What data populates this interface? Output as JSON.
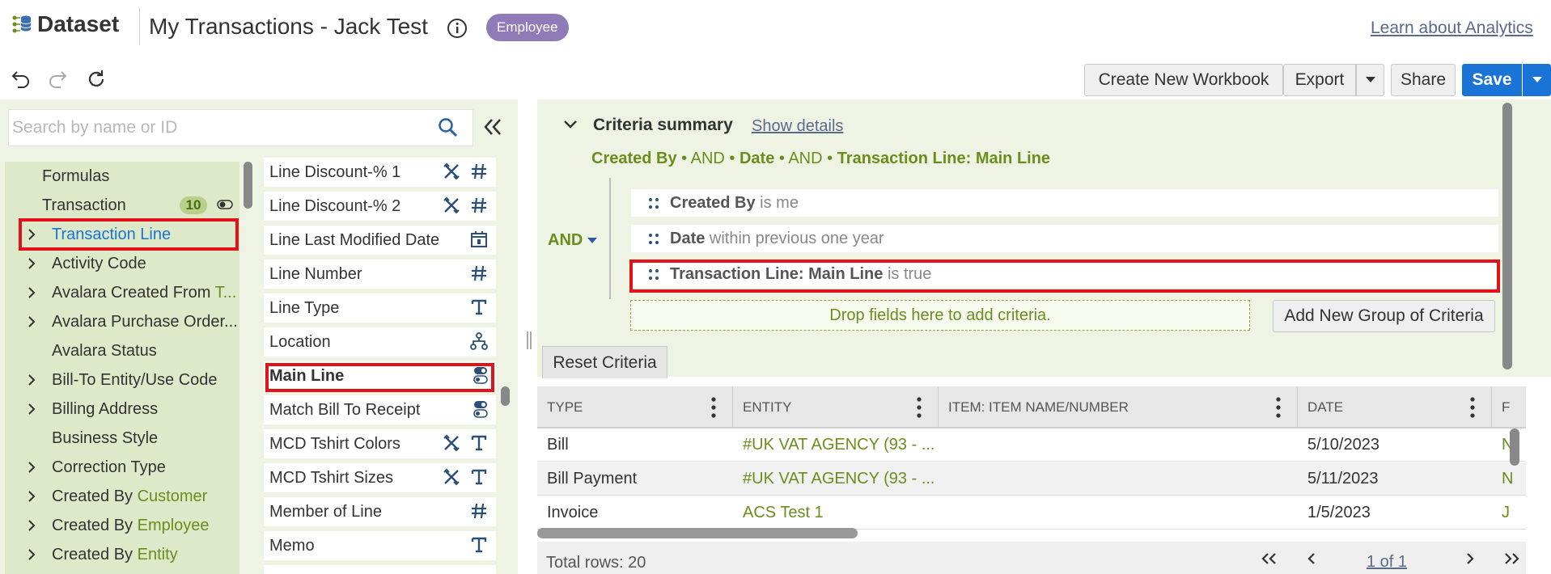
{
  "header": {
    "logo_text": "Dataset",
    "title": "My Transactions - Jack Test",
    "badge": "Employee",
    "learn_link": "Learn about Analytics"
  },
  "toolbar": {
    "create_workbook": "Create New Workbook",
    "export": "Export",
    "share": "Share",
    "save": "Save"
  },
  "search": {
    "placeholder": "Search by name or ID"
  },
  "tree": {
    "items": [
      {
        "label": "Formulas",
        "suffix": ""
      },
      {
        "label": "Transaction",
        "suffix": "",
        "count": "10"
      },
      {
        "label": "Transaction Line",
        "suffix": ""
      },
      {
        "label": "Activity Code",
        "suffix": ""
      },
      {
        "label": "Avalara Created From ",
        "suffix": "T..."
      },
      {
        "label": "Avalara Purchase Order...",
        "suffix": ""
      },
      {
        "label": "Avalara Status",
        "suffix": ""
      },
      {
        "label": "Bill-To Entity/Use Code",
        "suffix": ""
      },
      {
        "label": "Billing Address",
        "suffix": ""
      },
      {
        "label": "Business Style",
        "suffix": ""
      },
      {
        "label": "Correction Type",
        "suffix": ""
      },
      {
        "label": "Created By ",
        "suffix": "Customer"
      },
      {
        "label": "Created By ",
        "suffix": "Employee"
      },
      {
        "label": "Created By ",
        "suffix": "Entity"
      }
    ]
  },
  "fields": {
    "items": [
      {
        "label": "Line Discount-% 1",
        "icon": "number-icon"
      },
      {
        "label": "Line Discount-% 2",
        "icon": "number-icon"
      },
      {
        "label": "Line Last Modified Date",
        "icon": "calendar-icon"
      },
      {
        "label": "Line Number",
        "icon": "number-icon"
      },
      {
        "label": "Line Type",
        "icon": "text-icon"
      },
      {
        "label": "Location",
        "icon": "hierarchy-icon"
      },
      {
        "label": "Main Line",
        "icon": "toggle-icon"
      },
      {
        "label": "Match Bill To Receipt",
        "icon": "toggle-icon"
      },
      {
        "label": "MCD Tshirt Colors",
        "icon": "text-icon"
      },
      {
        "label": "MCD Tshirt Sizes",
        "icon": "text-icon"
      },
      {
        "label": "Member of Line",
        "icon": "number-icon"
      },
      {
        "label": "Memo",
        "icon": "text-icon"
      }
    ]
  },
  "criteria": {
    "title": "Criteria summary",
    "show_details": "Show details",
    "summary": {
      "f1": "Created By",
      "op1": " • AND • ",
      "f2": "Date",
      "op2": " • AND • ",
      "f3": "Transaction Line: Main Line"
    },
    "group_op": "AND",
    "rows": [
      {
        "field": "Created By",
        "cond": "is me"
      },
      {
        "field": "Date",
        "cond": "within previous one year"
      },
      {
        "field": "Transaction Line: Main Line",
        "cond": "is true"
      }
    ],
    "drop_hint": "Drop fields here to add criteria.",
    "add_group": "Add New Group of Criteria",
    "reset": "Reset Criteria"
  },
  "table": {
    "columns": [
      "TYPE",
      "ENTITY",
      "ITEM: ITEM NAME/NUMBER",
      "DATE",
      "F"
    ],
    "rows": [
      {
        "type": "Bill",
        "entity": "#UK VAT AGENCY (93 - ...",
        "item": "",
        "date": "5/10/2023",
        "extra": "N"
      },
      {
        "type": "Bill Payment",
        "entity": "#UK VAT AGENCY (93 - ...",
        "item": "",
        "date": "5/11/2023",
        "extra": "N"
      },
      {
        "type": "Invoice",
        "entity": "ACS Test 1",
        "item": "",
        "date": "1/5/2023",
        "extra": "J"
      }
    ],
    "total": "Total rows: 20",
    "page": "1 of 1"
  },
  "colors": {
    "accent_green": "#6a8e1c",
    "save_blue": "#1a74d6",
    "highlight_red": "#e0131b",
    "badge_purple": "#8e7bb8",
    "link_blue": "#1a74d6"
  }
}
